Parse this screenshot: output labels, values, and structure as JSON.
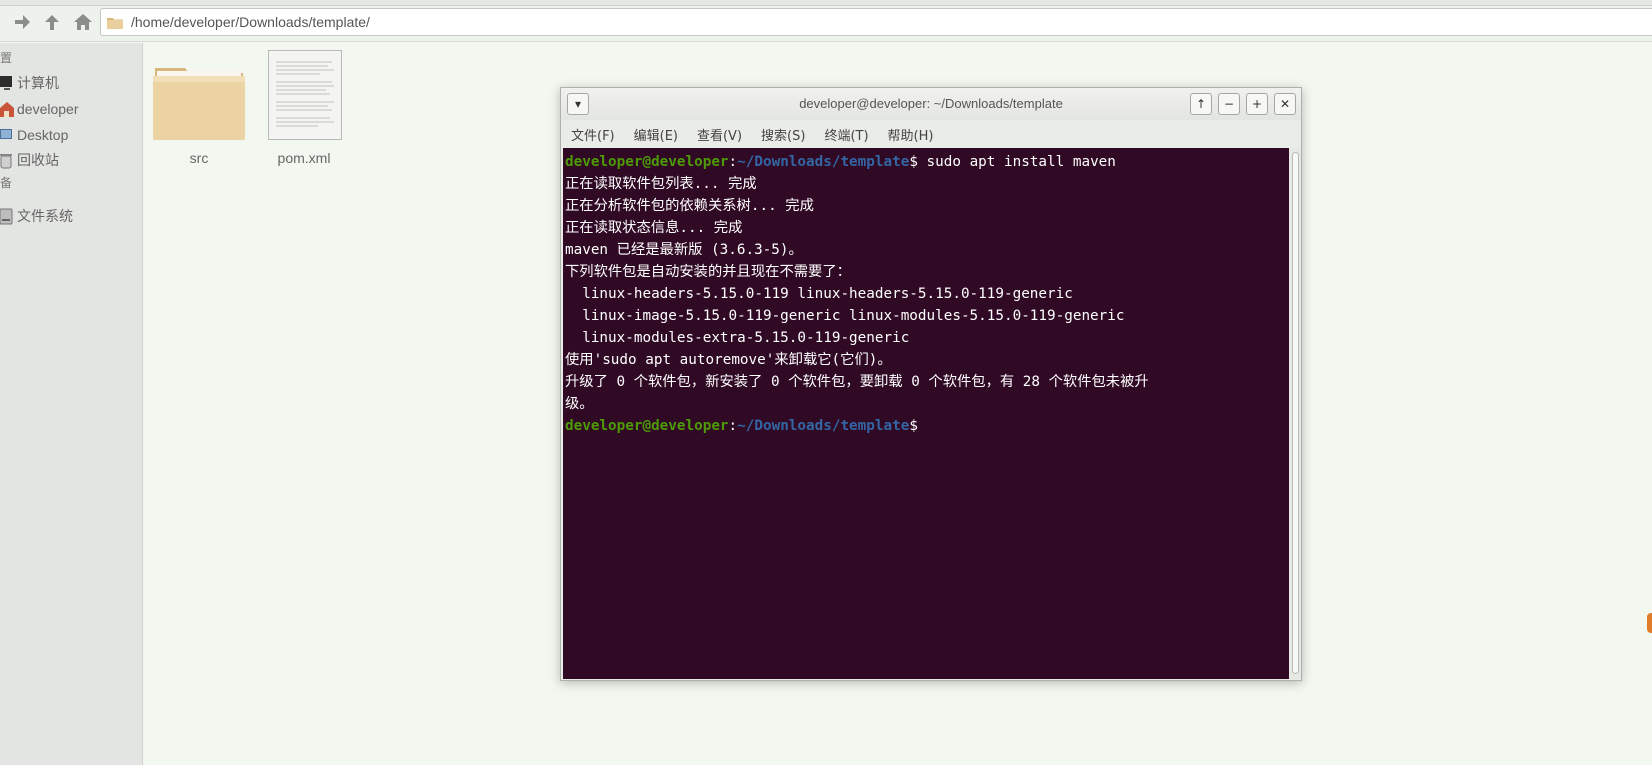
{
  "file_manager": {
    "address_path": "/home/developer/Downloads/template/",
    "sidebar": {
      "headings": [
        "置",
        "备"
      ],
      "items": [
        {
          "label": "计算机",
          "icon": "monitor-icon"
        },
        {
          "label": "developer",
          "icon": "home-icon"
        },
        {
          "label": "Desktop",
          "icon": "desktop-icon"
        },
        {
          "label": "回收站",
          "icon": "trash-icon"
        },
        {
          "label": "文件系统",
          "icon": "drive-icon"
        }
      ]
    },
    "files": [
      {
        "label": "src",
        "icon": "folder-icon"
      },
      {
        "label": "pom.xml",
        "icon": "document-icon"
      }
    ]
  },
  "terminal": {
    "title": "developer@developer: ~/Downloads/template",
    "buttons": {
      "menu": "▾",
      "raise": "↑",
      "minimize": "−",
      "maximize": "+",
      "close": "✕"
    },
    "menu": [
      "文件(F)",
      "编辑(E)",
      "查看(V)",
      "搜索(S)",
      "终端(T)",
      "帮助(H)"
    ],
    "prompt": {
      "user": "developer@developer",
      "colon": ":",
      "path": "~/Downloads/template",
      "symbol": "$"
    },
    "command": " sudo apt install maven",
    "output": [
      "正在读取软件包列表... 完成",
      "正在分析软件包的依赖关系树... 完成",
      "正在读取状态信息... 完成",
      "maven 已经是最新版 (3.6.3-5)。",
      "下列软件包是自动安装的并且现在不需要了：",
      "  linux-headers-5.15.0-119 linux-headers-5.15.0-119-generic",
      "  linux-image-5.15.0-119-generic linux-modules-5.15.0-119-generic",
      "  linux-modules-extra-5.15.0-119-generic",
      "使用'sudo apt autoremove'来卸载它(它们)。",
      "升级了 0 个软件包，新安装了 0 个软件包，要卸载 0 个软件包，有 28 个软件包未被升",
      "级。"
    ]
  }
}
